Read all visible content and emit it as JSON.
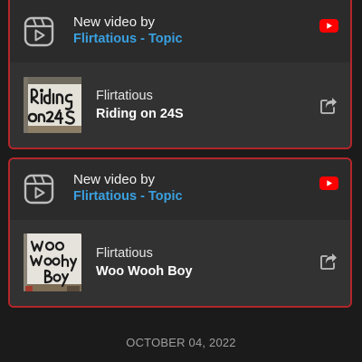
{
  "notifications": [
    {
      "header_line1": "New video by",
      "channel": "Flirtatious - Topic",
      "artist": "Flirtatious",
      "video_title": "Riding on 24S",
      "thumbnail_text": "Riding on24S"
    },
    {
      "header_line1": "New video by",
      "channel": "Flirtatious - Topic",
      "artist": "Flirtatious",
      "video_title": "Woo Wooh Boy",
      "thumbnail_text": "Woo Woohy Boy"
    }
  ],
  "date_label": "OCTOBER 04, 2022",
  "colors": {
    "background": "#1b1b1b",
    "card_border": "#b3262a",
    "channel_link": "#3aa0e0",
    "youtube_red": "#ff0000"
  },
  "icons": {
    "header": "video-play-box-icon",
    "source": "youtube-icon",
    "action": "share-icon"
  }
}
